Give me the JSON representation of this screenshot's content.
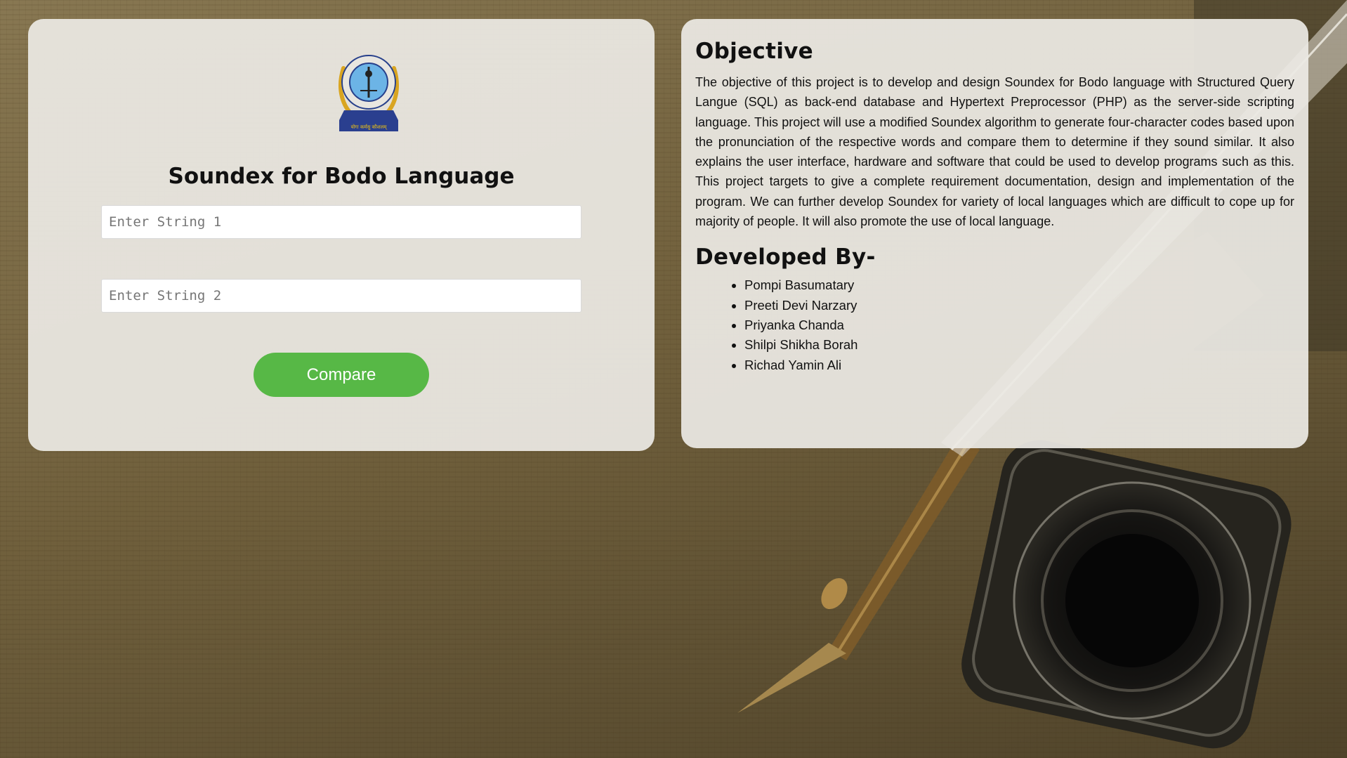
{
  "left": {
    "title": "Soundex for Bodo Language",
    "input1_placeholder": "Enter String 1",
    "input2_placeholder": "Enter String 2",
    "compare_label": "Compare",
    "logo": {
      "ring_text": "JORHAT ENGINEERING COLLEGE",
      "city_text": "JORHAT, ASSAM",
      "motto": "योगः कर्मसु कौशलम्"
    }
  },
  "right": {
    "objective_heading": "Objective",
    "objective_text": "The objective of this project is to develop and design Soundex for Bodo language with Structured Query Langue (SQL) as back-end database and Hypertext Preprocessor (PHP) as the server-side scripting language. This project will use a modified Soundex algorithm to generate four-character codes based upon the pronunciation of the respective words and compare them to determine if they sound similar. It also explains the user interface, hardware and software that could be used to develop programs such as this. This project targets to give a complete requirement documentation, design and implementation of the program. We can further develop Soundex for variety of local languages which are difficult to cope up for majority of people. It will also promote the use of local language.",
    "developed_heading": "Developed By-",
    "developers": [
      "Pompi Basumatary",
      "Preeti Devi Narzary",
      "Priyanka Chanda",
      "Shilpi Shikha Borah",
      "Richad Yamin Ali"
    ]
  },
  "colors": {
    "accent": "#57b846",
    "card": "#eceae4"
  }
}
